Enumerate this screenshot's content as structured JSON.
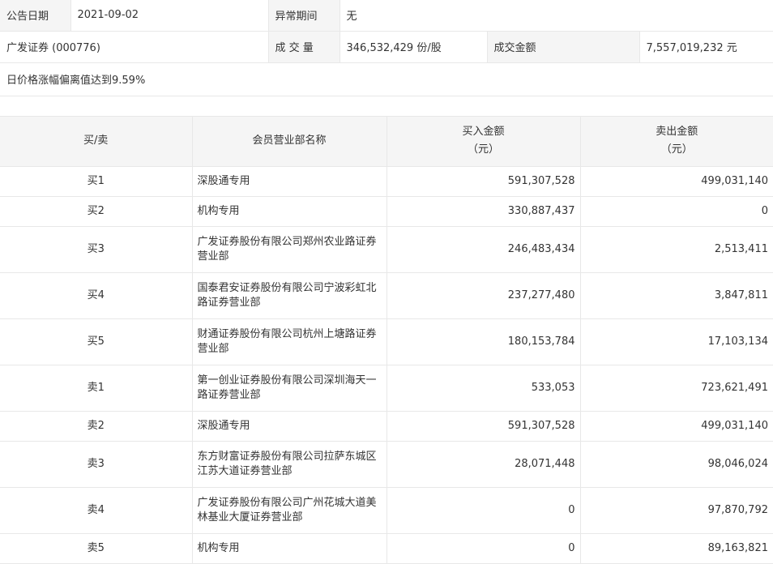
{
  "info": {
    "date_label": "公告日期",
    "date_value": "2021-09-02",
    "period_label": "异常期间",
    "period_value": "无",
    "stock": "广发证券 (000776)",
    "volume_label": "成 交 量",
    "volume_value": "346,532,429 份/股",
    "amount_label": "成交金额",
    "amount_value": "7,557,019,232 元",
    "reason": "日价格涨幅偏离值达到9.59%"
  },
  "table": {
    "headers": {
      "side": "买/卖",
      "member": "会员营业部名称",
      "buy_line1": "买入金额",
      "buy_line2": "（元）",
      "sell_line1": "卖出金额",
      "sell_line2": "（元）"
    },
    "rows": [
      {
        "side": "买1",
        "name": "深股通专用",
        "buy": "591,307,528",
        "sell": "499,031,140"
      },
      {
        "side": "买2",
        "name": "机构专用",
        "buy": "330,887,437",
        "sell": "0"
      },
      {
        "side": "买3",
        "name": "广发证券股份有限公司郑州农业路证券营业部",
        "buy": "246,483,434",
        "sell": "2,513,411"
      },
      {
        "side": "买4",
        "name": "国泰君安证券股份有限公司宁波彩虹北路证券营业部",
        "buy": "237,277,480",
        "sell": "3,847,811"
      },
      {
        "side": "买5",
        "name": "财通证券股份有限公司杭州上塘路证券营业部",
        "buy": "180,153,784",
        "sell": "17,103,134"
      },
      {
        "side": "卖1",
        "name": "第一创业证券股份有限公司深圳海天一路证券营业部",
        "buy": "533,053",
        "sell": "723,621,491"
      },
      {
        "side": "卖2",
        "name": "深股通专用",
        "buy": "591,307,528",
        "sell": "499,031,140"
      },
      {
        "side": "卖3",
        "name": "东方财富证券股份有限公司拉萨东城区江苏大道证券营业部",
        "buy": "28,071,448",
        "sell": "98,046,024"
      },
      {
        "side": "卖4",
        "name": "广发证券股份有限公司广州花城大道美林基业大厦证券营业部",
        "buy": "0",
        "sell": "97,870,792"
      },
      {
        "side": "卖5",
        "name": "机构专用",
        "buy": "0",
        "sell": "89,163,821"
      }
    ]
  }
}
